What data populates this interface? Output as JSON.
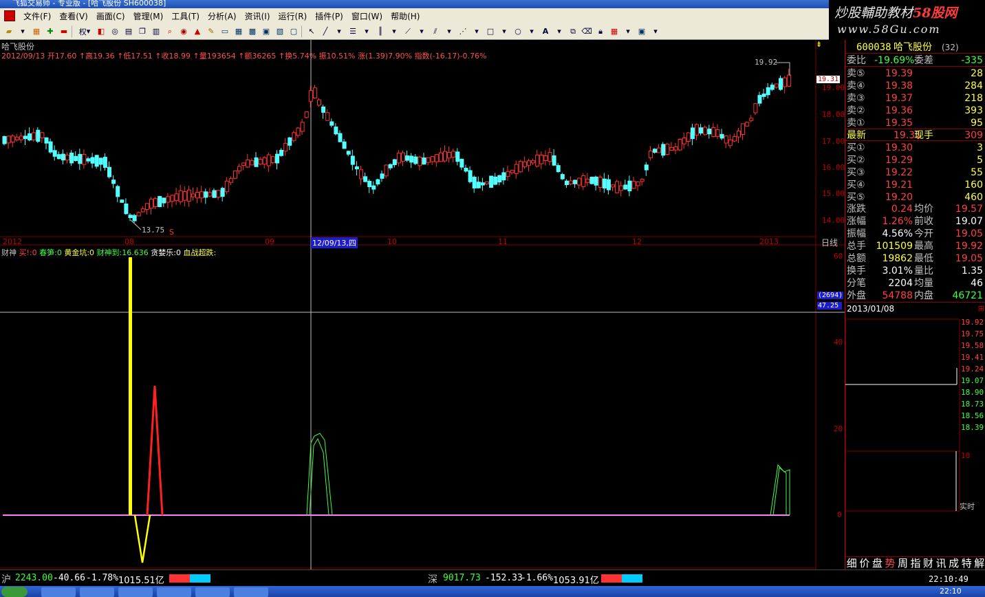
{
  "window": {
    "title": "飞狐交易师 - 专业版 - [哈飞股份 SH600038]"
  },
  "menu": [
    "文件(F)",
    "查看(V)",
    "画面(C)",
    "管理(M)",
    "工具(T)",
    "分析(A)",
    "资讯(I)",
    "运行(R)",
    "插件(P)",
    "窗口(W)",
    "帮助(H)"
  ],
  "toolbar": {
    "quan_label": "权"
  },
  "logo": {
    "line1a": "炒股輔助教材",
    "line1b": "58股网",
    "line2": "www.58Gu.com"
  },
  "stock_name_top": "哈飞股份",
  "info_line": "2012/09/13 开17.60 ↑高19.36 ↑低17.51 ↑收18.99 ↑量193654 ↑额36265 ↑换5.74% 振10.51% 涨(1.39)7.90% 指数(-16.17)-0.76%",
  "price_axis": [
    "19.00",
    "18.00",
    "17.00",
    "16.00",
    "15.00",
    "14.00"
  ],
  "current_price_tag": "19.31",
  "high_label": "19.92",
  "low_label": "13.75",
  "s_marker": "S",
  "date_axis": [
    {
      "t": "2012"
    },
    {
      "t": "08"
    },
    {
      "t": "09"
    },
    {
      "t": "12/09/13,四",
      "hl": true
    },
    {
      "t": "10"
    },
    {
      "t": "11"
    },
    {
      "t": "12"
    },
    {
      "t": "2013"
    }
  ],
  "period_label": "日线",
  "indicator": {
    "name": "财神",
    "items": [
      {
        "t": "买!:0",
        "c": "#ff4040"
      },
      {
        "t": "春笋:0",
        "c": "#40ff40"
      },
      {
        "t": "黄金坑:0",
        "c": "#ffff40"
      },
      {
        "t": "财神到:16.636",
        "c": "#40ff40"
      },
      {
        "t": "贪婪乐:0",
        "c": "#ffffff"
      },
      {
        "t": "血战超跌:",
        "c": "#ffff40"
      }
    ],
    "axis": [
      "60",
      "40",
      "20",
      "0"
    ],
    "cursor_tags": [
      "(2694)",
      "47.25"
    ]
  },
  "quote": {
    "code": "600038",
    "name": "哈飞股份",
    "count": "(32)",
    "weibi_label": "委比",
    "weibi": "-19.69%",
    "weicha_label": "委差",
    "weicha": "-335",
    "asks": [
      {
        "l": "卖⑤",
        "p": "19.39",
        "v": "28"
      },
      {
        "l": "卖④",
        "p": "19.38",
        "v": "284"
      },
      {
        "l": "卖③",
        "p": "19.37",
        "v": "218"
      },
      {
        "l": "卖②",
        "p": "19.36",
        "v": "393"
      },
      {
        "l": "卖①",
        "p": "19.35",
        "v": "95"
      }
    ],
    "latest_label": "最新",
    "latest": "19.31",
    "xianshou_label": "现手",
    "xianshou": "309",
    "bids": [
      {
        "l": "买①",
        "p": "19.30",
        "v": "3"
      },
      {
        "l": "买②",
        "p": "19.29",
        "v": "5"
      },
      {
        "l": "买③",
        "p": "19.22",
        "v": "55"
      },
      {
        "l": "买④",
        "p": "19.21",
        "v": "160"
      },
      {
        "l": "买⑤",
        "p": "19.20",
        "v": "460"
      }
    ],
    "stats": [
      {
        "a": "涨跌",
        "b": "0.24",
        "c": "均价",
        "d": "19.57",
        "bc": "#ff4040",
        "dc": "#ff4040"
      },
      {
        "a": "涨幅",
        "b": "1.26%",
        "c": "前收",
        "d": "19.07",
        "bc": "#ff4040",
        "dc": "#ffffff"
      },
      {
        "a": "振幅",
        "b": "4.56%",
        "c": "今开",
        "d": "19.05",
        "bc": "#ffffff",
        "dc": "#ff4040"
      },
      {
        "a": "总手",
        "b": "101509",
        "c": "最高",
        "d": "19.92",
        "bc": "#ffff40",
        "dc": "#ff4040"
      },
      {
        "a": "总额",
        "b": "19862",
        "c": "最低",
        "d": "19.05",
        "bc": "#ffff40",
        "dc": "#ff4040"
      },
      {
        "a": "换手",
        "b": "3.01%",
        "c": "量比",
        "d": "1.35",
        "bc": "#ffffff",
        "dc": "#ffffff"
      },
      {
        "a": "分笔",
        "b": "2204",
        "c": "均量",
        "d": "46",
        "bc": "#ffffff",
        "dc": "#ffffff"
      },
      {
        "a": "外盘",
        "b": "54788",
        "c": "内盘",
        "d": "46721",
        "bc": "#ff4040",
        "dc": "#40ff40"
      }
    ],
    "date": "2013/01/08",
    "intraday_axis": [
      "19.92",
      "19.75",
      "19.58",
      "19.41",
      "19.24",
      "19.07",
      "18.90",
      "18.73",
      "18.56",
      "18.39"
    ],
    "vol_axis": "10",
    "realtime_label": "实时",
    "tabs": [
      "细",
      "价",
      "盘",
      "势",
      "周",
      "指",
      "财",
      "讯",
      "成",
      "特",
      "解"
    ]
  },
  "status": {
    "sh_label": "沪",
    "sh_index": "2243.00",
    "sh_chg": "-40.66",
    "sh_pct": "-1.78%",
    "sh_amt": "1015.51亿",
    "sz_label": "深",
    "sz_index": "9017.73",
    "sz_chg": "-152.33",
    "sz_pct": "-1.66%",
    "sz_amt": "1053.91亿",
    "time": "22:10:49"
  },
  "taskbar": {
    "clock": "22:10"
  },
  "colors": {
    "up": "#ff3232",
    "down": "#54ffff",
    "bg": "#000000",
    "grid": "#800000"
  }
}
